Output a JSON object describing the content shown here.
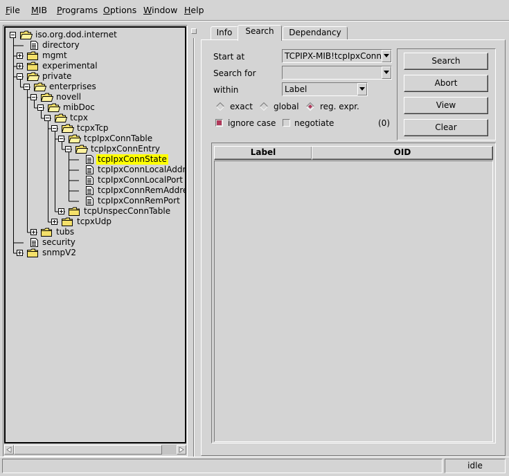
{
  "menubar": {
    "items": [
      {
        "mnemonic": "F",
        "rest": "ile"
      },
      {
        "mnemonic": "M",
        "rest": "IB"
      },
      {
        "mnemonic": "P",
        "rest": "rograms"
      },
      {
        "mnemonic": "O",
        "rest": "ptions"
      },
      {
        "mnemonic": "W",
        "rest": "indow"
      },
      {
        "mnemonic": "H",
        "rest": "elp"
      }
    ]
  },
  "tree": {
    "nodes": [
      {
        "label": "iso.org.dod.internet",
        "level": 0,
        "icon": "folder-open-icon",
        "expander": "minus"
      },
      {
        "label": "directory",
        "level": 1,
        "icon": "document-icon",
        "expander": "none"
      },
      {
        "label": "mgmt",
        "level": 1,
        "icon": "folder-icon",
        "expander": "plus"
      },
      {
        "label": "experimental",
        "level": 1,
        "icon": "folder-icon",
        "expander": "plus"
      },
      {
        "label": "private",
        "level": 1,
        "icon": "folder-open-icon",
        "expander": "minus"
      },
      {
        "label": "enterprises",
        "level": 2,
        "icon": "folder-open-icon",
        "expander": "minus"
      },
      {
        "label": "novell",
        "level": 3,
        "icon": "folder-open-icon",
        "expander": "minus"
      },
      {
        "label": "mibDoc",
        "level": 4,
        "icon": "folder-open-icon",
        "expander": "minus"
      },
      {
        "label": "tcpx",
        "level": 5,
        "icon": "folder-open-icon",
        "expander": "minus"
      },
      {
        "label": "tcpxTcp",
        "level": 6,
        "icon": "folder-open-icon",
        "expander": "minus"
      },
      {
        "label": "tcpIpxConnTable",
        "level": 7,
        "icon": "folder-open-icon",
        "expander": "minus"
      },
      {
        "label": "tcpIpxConnEntry",
        "level": 8,
        "icon": "folder-open-icon",
        "expander": "minus"
      },
      {
        "label": "tcpIpxConnState",
        "level": 9,
        "icon": "document-icon",
        "expander": "none",
        "selected": true
      },
      {
        "label": "tcpIpxConnLocalAddre",
        "level": 9,
        "icon": "document-icon",
        "expander": "none"
      },
      {
        "label": "tcpIpxConnLocalPort",
        "level": 9,
        "icon": "document-icon",
        "expander": "none"
      },
      {
        "label": "tcpIpxConnRemAddre",
        "level": 9,
        "icon": "document-icon",
        "expander": "none"
      },
      {
        "label": "tcpIpxConnRemPort",
        "level": 9,
        "icon": "document-icon",
        "expander": "none"
      },
      {
        "label": "tcpUnspecConnTable",
        "level": 7,
        "icon": "folder-icon",
        "expander": "plus"
      },
      {
        "label": "tcpxUdp",
        "level": 6,
        "icon": "folder-icon",
        "expander": "plus"
      },
      {
        "label": "tubs",
        "level": 3,
        "icon": "folder-icon",
        "expander": "plus"
      },
      {
        "label": "security",
        "level": 1,
        "icon": "document-icon",
        "expander": "none"
      },
      {
        "label": "snmpV2",
        "level": 1,
        "icon": "folder-icon",
        "expander": "plus"
      }
    ]
  },
  "tabs": [
    {
      "label": "Info"
    },
    {
      "label": "Search"
    },
    {
      "label": "Dependancy"
    }
  ],
  "search": {
    "start_at_label": "Start at",
    "start_at_value": "TCPIPX-MIB!tcpIpxConn",
    "search_for_label": "Search for",
    "search_for_value": "",
    "within_label": "within",
    "within_value": "Label",
    "mode_exact": "exact",
    "mode_global": "global",
    "mode_regexp": "reg. expr.",
    "ignore_case_label": "ignore case",
    "negotiate_label": "negotiate",
    "result_count": "(0)"
  },
  "buttons": {
    "search": "Search",
    "abort": "Abort",
    "view": "View",
    "clear": "Clear"
  },
  "results": {
    "col_label": "Label",
    "col_oid": "OID"
  },
  "status": {
    "text": "idle"
  },
  "colors": {
    "background": "#d4d4d4",
    "selection": "#ffff00",
    "radio_selected": "#b0385a"
  }
}
